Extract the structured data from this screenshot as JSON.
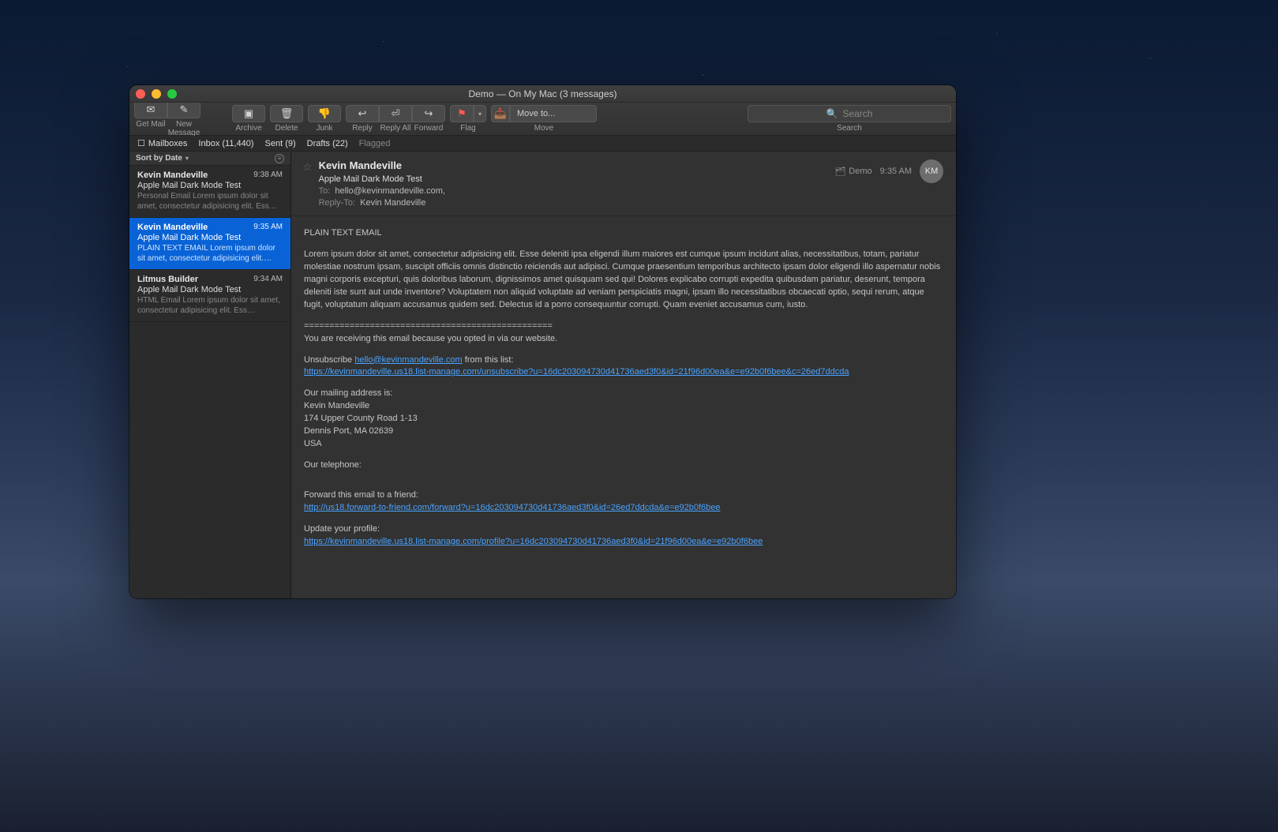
{
  "window_title": "Demo — On My Mac (3 messages)",
  "toolbar": {
    "get_mail": "Get Mail",
    "new_message": "New Message",
    "archive": "Archive",
    "delete": "Delete",
    "junk": "Junk",
    "reply": "Reply",
    "reply_all": "Reply All",
    "forward": "Forward",
    "flag": "Flag",
    "move": "Move",
    "move_to": "Move to...",
    "search_label": "Search",
    "search_placeholder": "Search"
  },
  "favbar": {
    "mailboxes": "Mailboxes",
    "inbox": "Inbox (11,440)",
    "sent": "Sent (9)",
    "drafts": "Drafts (22)",
    "flagged": "Flagged"
  },
  "list": {
    "sort_label": "Sort by Date",
    "items": [
      {
        "sender": "Kevin Mandeville",
        "time": "9:38 AM",
        "subject": "Apple Mail Dark Mode Test",
        "preview": "Personal Email Lorem ipsum dolor sit amet, consectetur adipisicing elit. Ess…"
      },
      {
        "sender": "Kevin Mandeville",
        "time": "9:35 AM",
        "subject": "Apple Mail Dark Mode Test",
        "preview": "PLAIN TEXT EMAIL Lorem ipsum dolor sit amet, consectetur adipisicing elit.…"
      },
      {
        "sender": "Litmus Builder",
        "time": "9:34 AM",
        "subject": "Apple Mail Dark Mode Test",
        "preview": "HTML Email Lorem ipsum dolor sit amet, consectetur adipisicing elit. Ess…"
      }
    ]
  },
  "reader": {
    "sender": "Kevin Mandeville",
    "subject": "Apple Mail Dark Mode Test",
    "to_label": "To:",
    "to_value": "hello@kevinmandeville.com,",
    "replyto_label": "Reply-To:",
    "replyto_value": "Kevin Mandeville",
    "mailbox": "Demo",
    "time": "9:35 AM",
    "avatar": "KM",
    "body_heading": "PLAIN TEXT EMAIL",
    "body_para": "Lorem ipsum dolor sit amet, consectetur adipisicing elit. Esse deleniti ipsa eligendi illum maiores est cumque ipsum incidunt alias, necessitatibus, totam, pariatur molestiae nostrum ipsam, suscipit officiis omnis distinctio reiciendis aut adipisci. Cumque praesentium temporibus architecto ipsam dolor eligendi illo aspernatur nobis magni corporis excepturi, quis doloribus laborum, dignissimos amet quisquam sed qui! Dolores explicabo corrupti expedita quibusdam pariatur, deserunt, tempora deleniti iste sunt aut unde inventore? Voluptatem non aliquid voluptate ad veniam perspiciatis magni, ipsam illo necessitatibus obcaecati optio, sequi rerum, atque fugit, voluptatum aliquam accusamus quidem sed. Delectus id a porro consequuntur corrupti. Quam eveniet accusamus cum, iusto.",
    "divider": "=================================================",
    "opt_in": "You are receiving this email because you opted in via our website.",
    "unsub_pre": "Unsubscribe ",
    "unsub_email": "hello@kevinmandeville.com",
    "unsub_post": " from this list:",
    "unsub_link": "https://kevinmandeville.us18.list-manage.com/unsubscribe?u=16dc203094730d41736aed3f0&id=21f96d00ea&e=e92b0f6bee&c=26ed7ddcda",
    "addr_label": "Our mailing address is:",
    "addr_name": "Kevin Mandeville",
    "addr_street": "174 Upper County Road 1-13",
    "addr_city": "Dennis Port, MA 02639",
    "addr_country": "USA",
    "tel_label": "Our telephone:",
    "fwd_label": "Forward this email to a friend:",
    "fwd_link": "http://us18.forward-to-friend.com/forward?u=16dc203094730d41736aed3f0&id=26ed7ddcda&e=e92b0f6bee",
    "upd_label": "Update your profile:",
    "upd_link": "https://kevinmandeville.us18.list-manage.com/profile?u=16dc203094730d41736aed3f0&id=21f96d00ea&e=e92b0f6bee"
  }
}
